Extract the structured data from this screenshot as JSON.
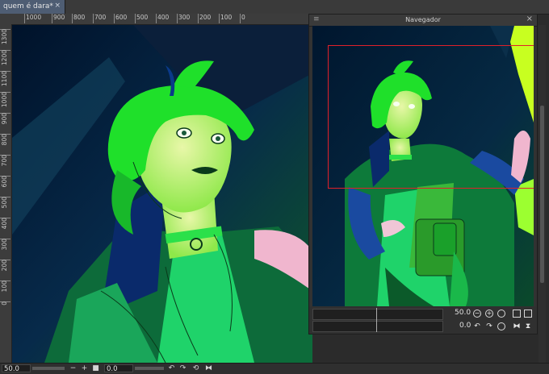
{
  "document_tab": {
    "title": "quem é dara*",
    "close_icon": "×"
  },
  "ruler": {
    "horizontal_labels": [
      "1000",
      "900",
      "800",
      "700",
      "600",
      "500",
      "400",
      "300",
      "200",
      "100",
      "0"
    ],
    "vertical_labels": [
      "1300",
      "1200",
      "1100",
      "1000",
      "900",
      "800",
      "700",
      "600",
      "500",
      "400",
      "300",
      "200",
      "100",
      "0"
    ]
  },
  "navigator": {
    "title": "Navegador",
    "zoom_value": "50.0",
    "rotation_value": "0.0"
  },
  "statusbar": {
    "zoom_value": "50.0",
    "rotation_value": "0.0",
    "minus_label": "−",
    "plus_label": "+"
  },
  "icons": {
    "grip": "≡",
    "close": "×",
    "zoom_out": "−",
    "zoom_in": "+",
    "fit": "■",
    "rotate_ccw": "↶",
    "rotate_cw": "↷",
    "reset": "⟲"
  },
  "colors": {
    "tab_active": "#4e5d73",
    "navigator_viewport_border": "#e0202a",
    "artwork_green": "#1fe02a",
    "artwork_navy": "#0a2a6b"
  }
}
